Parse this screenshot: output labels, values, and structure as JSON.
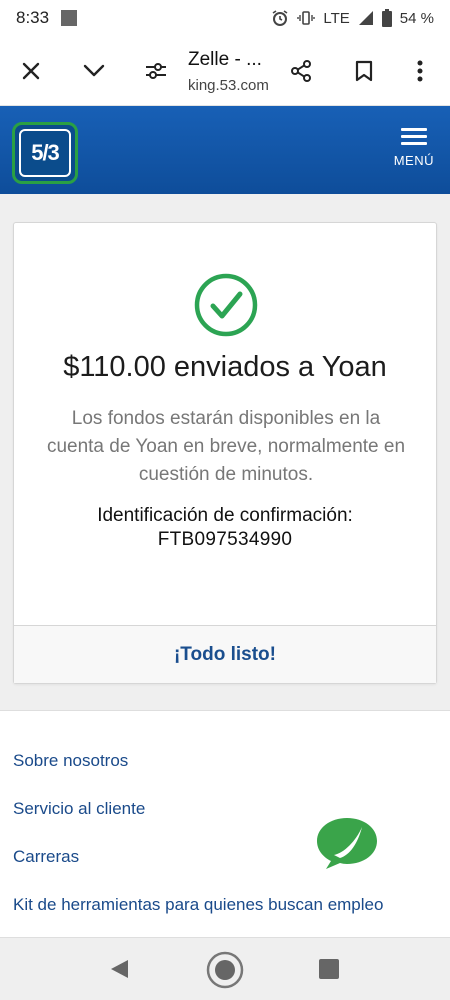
{
  "status_bar": {
    "time": "8:33",
    "network": "LTE",
    "battery": "54 %"
  },
  "browser": {
    "title": "Zelle - ...",
    "url": "king.53.com"
  },
  "bank": {
    "logo_text": "5/3",
    "menu_label": "MENÚ"
  },
  "confirmation": {
    "amount_line": "$110.00 enviados a Yoan",
    "description": "Los fondos estarán disponibles en la cuenta de Yoan en breve, normalmente en cuestión de minutos.",
    "id_label": "Identificación de confirmación:",
    "id_value": "FTB097534990",
    "done_label": "¡Todo listo!"
  },
  "footer": {
    "links": [
      "Sobre nosotros",
      "Servicio al cliente",
      "Carreras",
      "Kit de herramientas para quienes buscan empleo"
    ]
  },
  "colors": {
    "header_blue": "#1860b6",
    "success_green": "#2ca453",
    "link_blue": "#1a4a8a",
    "chat_green": "#3aa44a"
  }
}
